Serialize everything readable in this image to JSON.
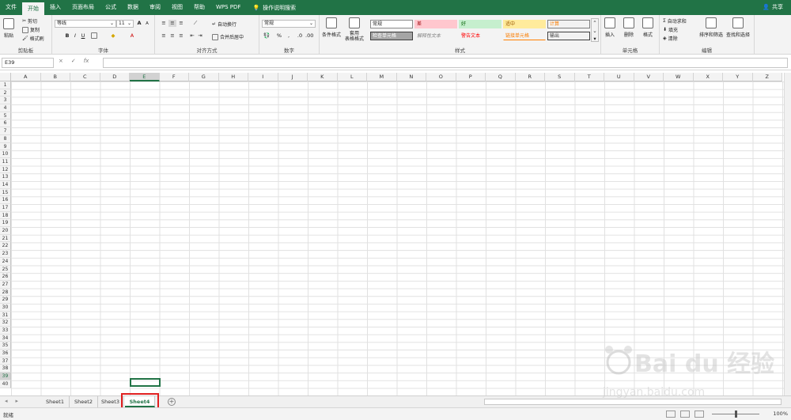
{
  "tabs": [
    "文件",
    "开始",
    "插入",
    "页面布局",
    "公式",
    "数据",
    "审阅",
    "视图",
    "帮助",
    "WPS PDF"
  ],
  "active_tab_index": 1,
  "tell_me": "操作说明搜索",
  "share": "共享",
  "ribbon": {
    "clipboard": {
      "paste": "粘贴",
      "cut": "剪切",
      "copy": "复制",
      "format_painter": "格式刷",
      "label": "剪贴板"
    },
    "font": {
      "name": "等线",
      "size": "11",
      "bold": "B",
      "italic": "I",
      "underline": "U",
      "grow": "A",
      "shrink": "A",
      "label": "字体"
    },
    "alignment": {
      "wrap": "自动换行",
      "merge": "合并后居中",
      "label": "对齐方式"
    },
    "number": {
      "format": "常规",
      "percent": "%",
      "comma": ",",
      "label": "数字"
    },
    "styles": {
      "conditional": "条件格式",
      "table": "套用\n表格格式",
      "cells": [
        "常规",
        "差",
        "好",
        "适中",
        "计算",
        "检查单元格",
        "解释性文本",
        "警告文本",
        "链接单元格",
        "输出"
      ],
      "label": "样式"
    },
    "cells_group": {
      "insert": "插入",
      "delete": "删除",
      "format": "格式",
      "label": "单元格"
    },
    "editing": {
      "autosum": "自动求和",
      "fill": "填充",
      "clear": "清除",
      "sort": "排序和筛选",
      "find": "查找和选择",
      "label": "编辑"
    }
  },
  "formula_bar": {
    "name_box": "E39",
    "cancel": "×",
    "enter": "✓",
    "fx": "fx",
    "content": ""
  },
  "columns": [
    "A",
    "B",
    "C",
    "D",
    "E",
    "F",
    "G",
    "H",
    "I",
    "J",
    "K",
    "L",
    "M",
    "N",
    "O",
    "P",
    "Q",
    "R",
    "S",
    "T",
    "U",
    "V",
    "W",
    "X",
    "Y",
    "Z"
  ],
  "selected_column": "E",
  "rows": [
    "1",
    "2",
    "3",
    "4",
    "5",
    "6",
    "7",
    "8",
    "9",
    "10",
    "11",
    "12",
    "13",
    "14",
    "15",
    "16",
    "17",
    "18",
    "19",
    "20",
    "21",
    "22",
    "23",
    "24",
    "25",
    "26",
    "27",
    "28",
    "29",
    "30",
    "31",
    "32",
    "33",
    "34",
    "35",
    "36",
    "37",
    "38",
    "39",
    "40"
  ],
  "selected_row": "39",
  "sheets": [
    "Sheet1",
    "Sheet2",
    "Sheet3",
    "Sheet4"
  ],
  "active_sheet": "Sheet4",
  "status": {
    "ready": "就绪",
    "zoom": "100%"
  },
  "colors": {
    "accent": "#217346",
    "highlight": "#e02020"
  }
}
